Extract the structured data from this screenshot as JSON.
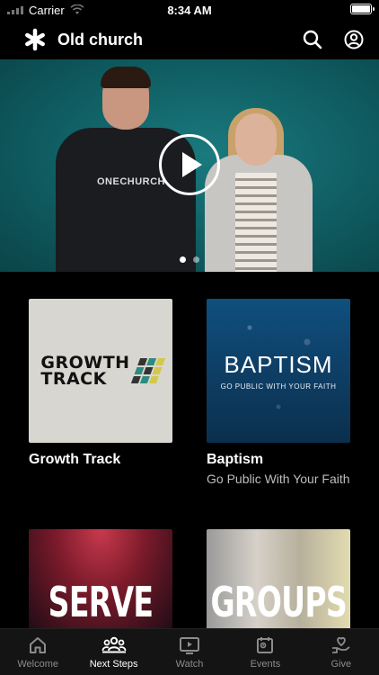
{
  "status_bar": {
    "carrier": "Carrier",
    "time": "8:34 AM"
  },
  "header": {
    "title": "Old church",
    "logo_icon": "asterisk-icon",
    "search_icon": "search-icon",
    "account_icon": "account-icon"
  },
  "hero": {
    "shirt_text": "ONECHURCH",
    "carousel": {
      "page_count": 2,
      "active_index": 0
    }
  },
  "cards": [
    {
      "image_text_1": "GROWTH",
      "image_text_2": "TRACK",
      "title": "Growth Track",
      "subtitle": ""
    },
    {
      "image_text_1": "BAPTISM",
      "image_text_2": "GO PUBLIC WITH YOUR FAITH",
      "title": "Baptism",
      "subtitle": "Go Public With Your Faith"
    },
    {
      "image_text_1": "SERVE",
      "title": "",
      "subtitle": ""
    },
    {
      "image_text_1": "GROUPS",
      "title": "",
      "subtitle": ""
    }
  ],
  "tabs": [
    {
      "label": "Welcome",
      "icon": "home-icon",
      "active": false
    },
    {
      "label": "Next Steps",
      "icon": "people-icon",
      "active": true
    },
    {
      "label": "Watch",
      "icon": "play-screen-icon",
      "active": false
    },
    {
      "label": "Events",
      "icon": "calendar-icon",
      "active": false
    },
    {
      "label": "Give",
      "icon": "heart-hand-icon",
      "active": false
    }
  ],
  "colors": {
    "accent": "#ffffff",
    "background": "#000000",
    "tab_inactive": "#8c8c8c"
  }
}
